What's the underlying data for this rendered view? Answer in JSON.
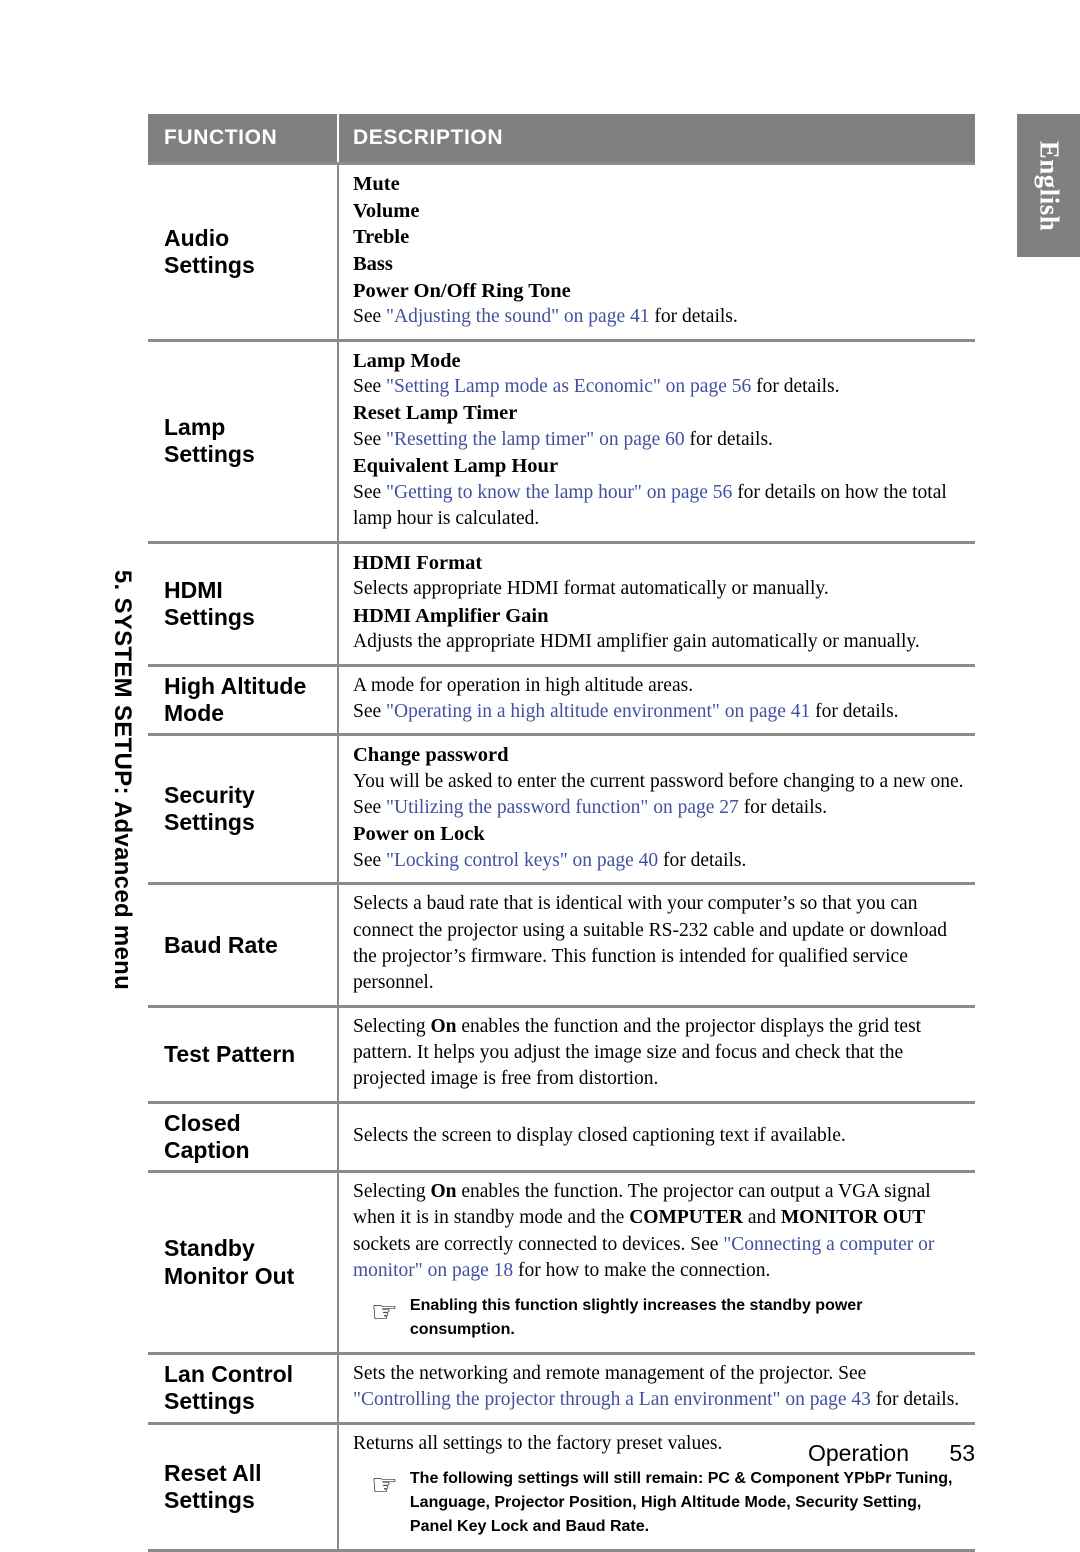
{
  "language_tab": {
    "label": "English"
  },
  "chapter_label": {
    "text": "5. SYSTEM SETUP: Advanced menu"
  },
  "table": {
    "headers": {
      "function": "FUNCTION",
      "description": "DESCRIPTION"
    },
    "rows": [
      {
        "function": "Audio\nSettings",
        "lines": [
          {
            "type": "bold",
            "text": "Mute"
          },
          {
            "type": "bold",
            "text": "Volume"
          },
          {
            "type": "bold",
            "text": "Treble"
          },
          {
            "type": "bold",
            "text": "Bass"
          },
          {
            "type": "bold",
            "text": "Power On/Off Ring Tone"
          },
          {
            "type": "mixed",
            "pre": "See ",
            "link": "\"Adjusting the sound\" on page 41",
            "post": " for details."
          }
        ]
      },
      {
        "function": "Lamp\nSettings",
        "lines": [
          {
            "type": "bold",
            "text": "Lamp Mode"
          },
          {
            "type": "mixed",
            "pre": "See ",
            "link": "\"Setting Lamp mode as Economic\" on page 56",
            "post": " for details."
          },
          {
            "type": "bold",
            "text": "Reset Lamp Timer"
          },
          {
            "type": "mixed",
            "pre": "See ",
            "link": "\"Resetting the lamp timer\" on page 60",
            "post": " for details."
          },
          {
            "type": "bold",
            "text": "Equivalent Lamp Hour"
          },
          {
            "type": "mixed",
            "pre": "See ",
            "link": "\"Getting to know the lamp hour\" on page 56",
            "post": " for details on how the total lamp hour is calculated."
          }
        ]
      },
      {
        "function": "HDMI\nSettings",
        "lines": [
          {
            "type": "bold",
            "text": "HDMI Format"
          },
          {
            "type": "plain",
            "text": "Selects appropriate HDMI format automatically or manually."
          },
          {
            "type": "bold",
            "text": "HDMI Amplifier Gain"
          },
          {
            "type": "plain",
            "text": "Adjusts the appropriate HDMI amplifier gain automatically or manually."
          }
        ]
      },
      {
        "function": "High Altitude\nMode",
        "lines": [
          {
            "type": "plain",
            "text": "A mode for operation in high altitude areas."
          },
          {
            "type": "mixed",
            "pre": "See ",
            "link": "\"Operating in a high altitude environment\" on page 41",
            "post": " for details."
          }
        ]
      },
      {
        "function": "Security\nSettings",
        "lines": [
          {
            "type": "bold",
            "text": "Change password"
          },
          {
            "type": "mixed",
            "pre": "You will be asked to enter the current password before changing to a new one. See ",
            "link": "\"Utilizing the password function\" on page 27",
            "post": " for details."
          },
          {
            "type": "bold",
            "text": "Power on Lock"
          },
          {
            "type": "mixed",
            "pre": "See ",
            "link": "\"Locking control keys\" on page 40",
            "post": " for details."
          }
        ]
      },
      {
        "function": "Baud Rate",
        "lines": [
          {
            "type": "plain",
            "text": "Selects a baud rate that is identical with your computer’s so that you can connect the projector using a suitable RS-232 cable and update or download the projector’s firmware. This function is intended for qualified service personnel."
          }
        ]
      },
      {
        "function": "Test Pattern",
        "lines": [
          {
            "type": "emph",
            "pre": "Selecting ",
            "em": "On",
            "post": " enables the function and the projector displays the grid test pattern. It helps you adjust the image size and focus and check that the projected image is free from distortion."
          }
        ]
      },
      {
        "function": "Closed Caption",
        "lines": [
          {
            "type": "plain",
            "text": "Selects the screen to display closed captioning text if available."
          }
        ]
      },
      {
        "function": "Standby\nMonitor Out",
        "lines": [
          {
            "type": "standby"
          }
        ],
        "note": {
          "icon": "pointing-hand-icon",
          "glyph": "☞",
          "text": "Enabling this function slightly increases the standby power consumption."
        }
      },
      {
        "function": "Lan Control\nSettings",
        "lines": [
          {
            "type": "mixed",
            "pre": "Sets the networking and remote management of the projector. See ",
            "link": "\"Controlling the projector through a Lan environment\" on page 43",
            "post": " for details."
          }
        ]
      },
      {
        "function": "Reset All\nSettings",
        "lines": [
          {
            "type": "plain",
            "text": "Returns all settings to the factory preset values."
          }
        ],
        "note": {
          "icon": "pointing-hand-icon",
          "glyph": "☞",
          "text": "The following settings will still remain: PC & Component YPbPr Tuning, Language, Projector Position, High Altitude Mode, Security Setting, Panel Key Lock and Baud Rate."
        }
      }
    ]
  },
  "standby_text": {
    "seg1": "Selecting ",
    "em1": "On",
    "seg2": " enables the function. The projector can output a VGA signal when it is in standby mode and the ",
    "em2": "COMPUTER",
    "seg3": " and ",
    "em3": "MONITOR OUT",
    "seg4": " sockets are correctly connected to devices. See ",
    "link": "\"Connecting a computer or monitor\" on page 18",
    "seg5": " for how to make the connection."
  },
  "footer": {
    "section": "Operation",
    "page": "53"
  },
  "colors": {
    "header_gray": "#808080",
    "rule_gray": "#8b8b8b",
    "link_blue": "#4150a0"
  }
}
